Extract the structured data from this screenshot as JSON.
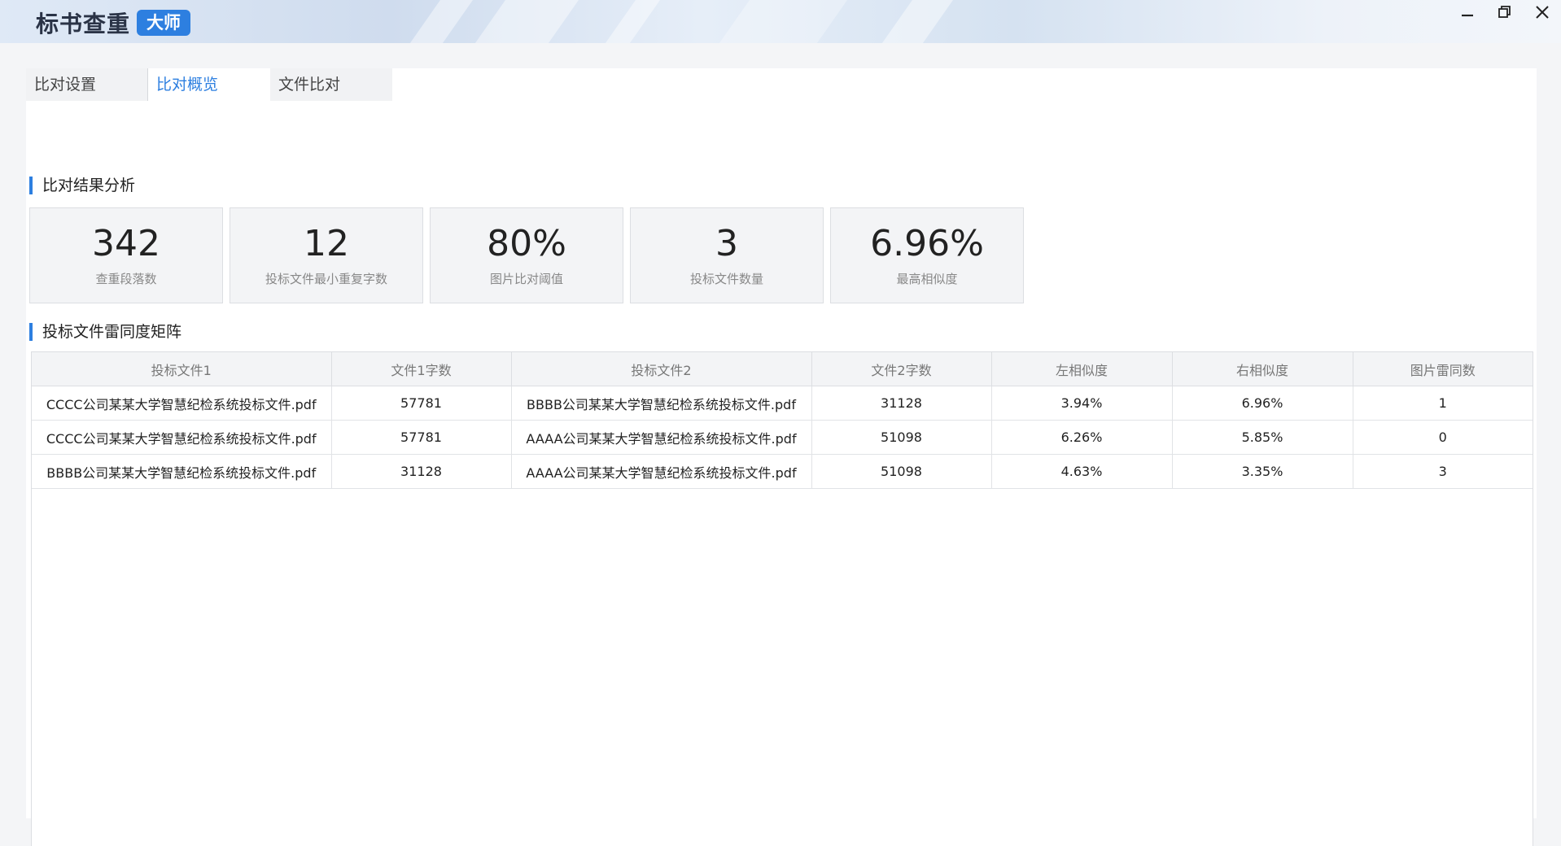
{
  "app": {
    "name": "标书查重",
    "tag": "大师"
  },
  "window_controls": {
    "minimize_icon": "minimize-icon",
    "restore_icon": "restore-icon",
    "close_icon": "close-icon"
  },
  "tabs": [
    {
      "label": "比对设置",
      "active": false
    },
    {
      "label": "比对概览",
      "active": true
    },
    {
      "label": "文件比对",
      "active": false
    }
  ],
  "analysis": {
    "title": "比对结果分析",
    "stats": [
      {
        "value": "342",
        "label": "查重段落数"
      },
      {
        "value": "12",
        "label": "投标文件最小重复字数"
      },
      {
        "value": "80%",
        "label": "图片比对阈值"
      },
      {
        "value": "3",
        "label": "投标文件数量"
      },
      {
        "value": "6.96%",
        "label": "最高相似度"
      }
    ]
  },
  "matrix": {
    "title": "投标文件雷同度矩阵",
    "columns": [
      "投标文件1",
      "文件1字数",
      "投标文件2",
      "文件2字数",
      "左相似度",
      "右相似度",
      "图片雷同数"
    ],
    "rows": [
      [
        "CCCC公司某某大学智慧纪检系统投标文件.pdf",
        "57781",
        "BBBB公司某某大学智慧纪检系统投标文件.pdf",
        "31128",
        "3.94%",
        "6.96%",
        "1"
      ],
      [
        "CCCC公司某某大学智慧纪检系统投标文件.pdf",
        "57781",
        "AAAA公司某某大学智慧纪检系统投标文件.pdf",
        "51098",
        "6.26%",
        "5.85%",
        "0"
      ],
      [
        "BBBB公司某某大学智慧纪检系统投标文件.pdf",
        "31128",
        "AAAA公司某某大学智慧纪检系统投标文件.pdf",
        "51098",
        "4.63%",
        "3.35%",
        "3"
      ]
    ]
  },
  "colors": {
    "accent": "#2d7fe0",
    "card_bg": "#f3f4f6",
    "border": "#dcdee2"
  }
}
